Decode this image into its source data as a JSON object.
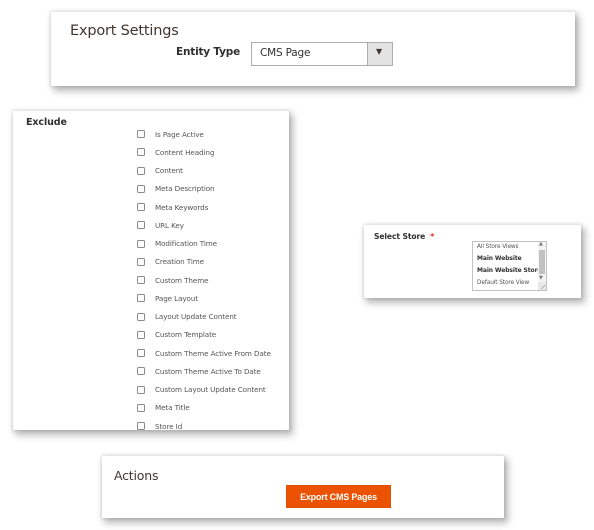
{
  "export_settings": {
    "title": "Export Settings",
    "entity_type_label": "Entity Type",
    "entity_type_value": "CMS Page",
    "dropdown_arrow": "▼"
  },
  "exclude": {
    "title": "Exclude",
    "fields": [
      {
        "label": "Is Page Active",
        "checked": false
      },
      {
        "label": "Content Heading",
        "checked": false
      },
      {
        "label": "Content",
        "checked": false
      },
      {
        "label": "Meta Description",
        "checked": false
      },
      {
        "label": "Meta Keywords",
        "checked": false
      },
      {
        "label": "URL Key",
        "checked": false
      },
      {
        "label": "Modification Time",
        "checked": false
      },
      {
        "label": "Creation Time",
        "checked": false
      },
      {
        "label": "Custom Theme",
        "checked": false
      },
      {
        "label": "Page Layout",
        "checked": false
      },
      {
        "label": "Layout Update Content",
        "checked": false
      },
      {
        "label": "Custom Template",
        "checked": false
      },
      {
        "label": "Custom Theme Active From Date",
        "checked": false
      },
      {
        "label": "Custom Theme Active To Date",
        "checked": false
      },
      {
        "label": "Custom Layout Update Content",
        "checked": false
      },
      {
        "label": "Meta Title",
        "checked": false
      },
      {
        "label": "Store Id",
        "checked": false
      }
    ]
  },
  "select_store": {
    "label": "Select Store",
    "required_marker": "*",
    "options": [
      {
        "label": "All Store Views",
        "group": false
      },
      {
        "label": "Main Website",
        "group": true
      },
      {
        "label": "Main Website Store",
        "group": true
      },
      {
        "label": "Default Store View",
        "group": false
      }
    ],
    "scroll_up": "▲",
    "scroll_down": "▼"
  },
  "actions": {
    "title": "Actions",
    "export_button_label": "Export CMS Pages",
    "button_color": "#eb5202"
  }
}
